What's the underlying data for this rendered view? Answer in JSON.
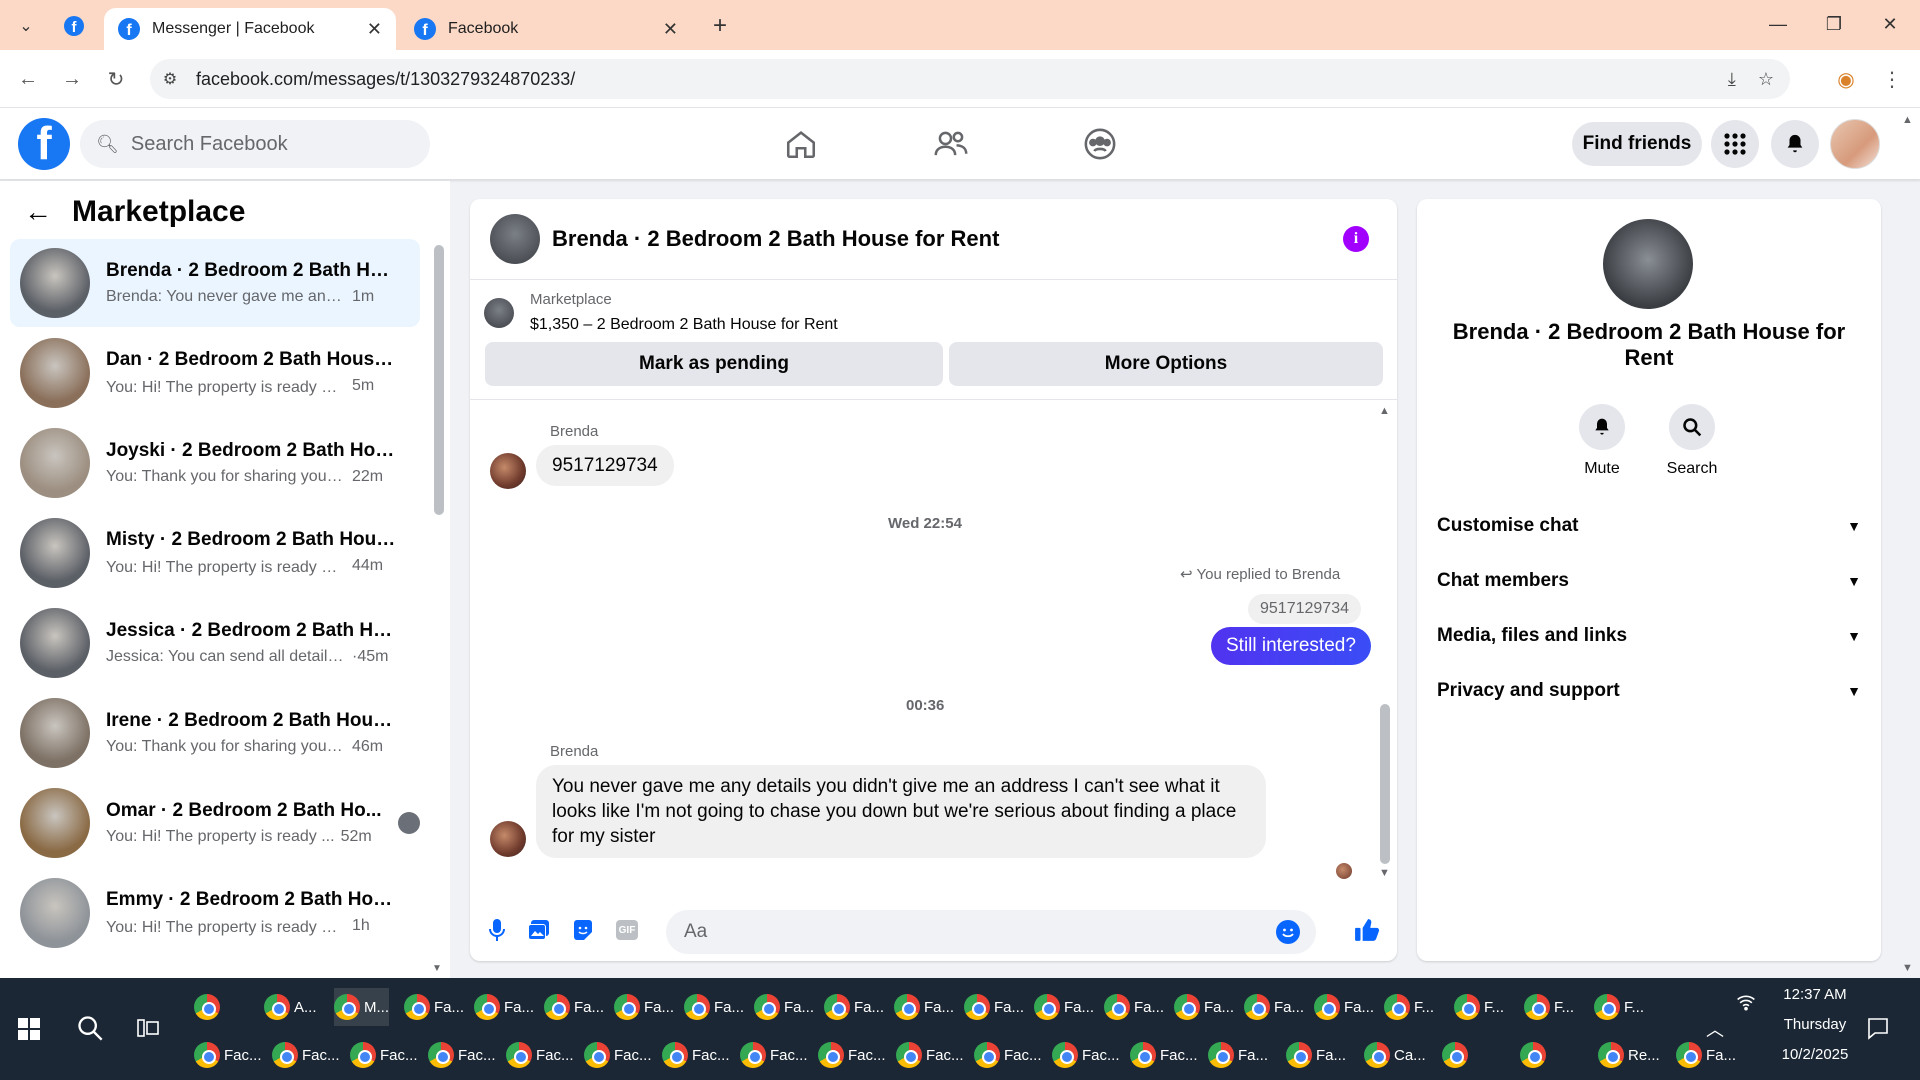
{
  "browser": {
    "tabs": [
      {
        "title": "Messenger | Facebook",
        "active": true
      },
      {
        "title": "Facebook",
        "active": false
      }
    ],
    "url": "facebook.com/messages/t/1303279324870233/"
  },
  "fb": {
    "search_placeholder": "Search Facebook",
    "find_friends": "Find friends"
  },
  "left": {
    "title": "Marketplace",
    "conversations": [
      {
        "name": "Brenda · 2 Bedroom 2 Bath Hou...",
        "preview": "Brenda: You never gave me any de...",
        "time": "1m",
        "thumb": "#5b5f66"
      },
      {
        "name": "Dan · 2 Bedroom 2 Bath House f...",
        "preview": "You: Hi! The property is ready ✨ I'...",
        "time": "5m",
        "thumb": "#8a6f5a"
      },
      {
        "name": "Joyski · 2 Bedroom 2 Bath Hous...",
        "preview": "You: Thank you for sharing your n...",
        "time": "22m",
        "thumb": "#9c8e80"
      },
      {
        "name": "Misty · 2 Bedroom 2 Bath House...",
        "preview": "You: Hi! The property is ready ✨...",
        "time": "44m",
        "thumb": "#5b5f66"
      },
      {
        "name": "Jessica · 2 Bedroom 2 Bath Hous...",
        "preview": "Jessica: You can send all details h...",
        "time": "·45m",
        "thumb": "#5b5f66"
      },
      {
        "name": "Irene · 2 Bedroom 2 Bath House ...",
        "preview": "You: Thank you for sharing your n...",
        "time": "46m",
        "thumb": "#7d7064"
      },
      {
        "name": "Omar · 2 Bedroom 2 Bath Ho...",
        "preview": "You: Hi! The property is ready ...",
        "time": "52m",
        "thumb": "#8a6a45"
      },
      {
        "name": "Emmy · 2 Bedroom 2 Bath Hous...",
        "preview": "You: Hi! The property is ready ✨ I'l...",
        "time": "1h",
        "thumb": "#8e9399"
      }
    ]
  },
  "chat": {
    "title": "Brenda · 2 Bedroom 2 Bath House for Rent",
    "marketplace_label": "Marketplace",
    "listing": "$1,350 – 2 Bedroom 2 Bath House for Rent",
    "mark_pending": "Mark as pending",
    "more_options": "More Options",
    "messages": {
      "sender1": "Brenda",
      "msg1": "9517129734",
      "ts1": "Wed 22:54",
      "replied": "You replied to Brenda",
      "quoted": "9517129734",
      "out1": "Still interested?",
      "ts2": "00:36",
      "sender2": "Brenda",
      "msg2": "You never gave me any details you didn't give me an address I can't see what it looks like I'm not going to chase you down but we're serious about finding a place for my sister"
    },
    "composer_placeholder": "Aa"
  },
  "right": {
    "name": "Brenda · 2 Bedroom 2 Bath House for Rent",
    "mute": "Mute",
    "search": "Search",
    "sections": [
      "Customise chat",
      "Chat members",
      "Media, files and links",
      "Privacy and support"
    ]
  },
  "taskbar": {
    "row1": [
      "",
      "A...",
      "M...",
      "Fa...",
      "Fa...",
      "Fa...",
      "Fa...",
      "Fa...",
      "Fa...",
      "Fa...",
      "Fa...",
      "Fa...",
      "Fa...",
      "Fa...",
      "Fa...",
      "Fa...",
      "Fa...",
      "F...",
      "F...",
      "F...",
      "F..."
    ],
    "row2": [
      "Fac...",
      "Fac...",
      "Fac...",
      "Fac...",
      "Fac...",
      "Fac...",
      "Fac...",
      "Fac...",
      "Fac...",
      "Fac...",
      "Fac...",
      "Fac...",
      "Fac...",
      "Fa...",
      "Fa...",
      "Ca...",
      "",
      "",
      "Re...",
      "Fa..."
    ],
    "time": "12:37 AM",
    "day": "Thursday",
    "date": "10/2/2025"
  }
}
